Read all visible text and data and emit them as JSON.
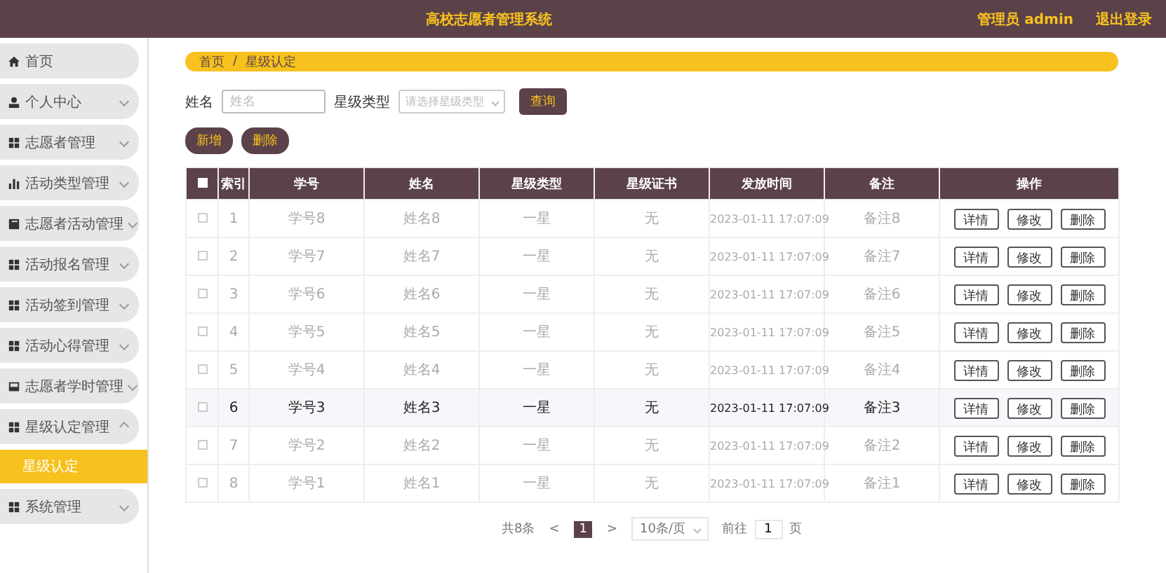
{
  "header": {
    "title": "高校志愿者管理系统",
    "user": "管理员 admin",
    "logout": "退出登录"
  },
  "sidebar": {
    "items": [
      {
        "label": "首页",
        "kind": "link"
      },
      {
        "label": "个人中心",
        "kind": "menu",
        "expanded": false
      },
      {
        "label": "志愿者管理",
        "kind": "menu",
        "expanded": false
      },
      {
        "label": "活动类型管理",
        "kind": "menu",
        "expanded": false
      },
      {
        "label": "志愿者活动管理",
        "kind": "menu",
        "expanded": false
      },
      {
        "label": "活动报名管理",
        "kind": "menu",
        "expanded": false
      },
      {
        "label": "活动签到管理",
        "kind": "menu",
        "expanded": false
      },
      {
        "label": "活动心得管理",
        "kind": "menu",
        "expanded": false
      },
      {
        "label": "志愿者学时管理",
        "kind": "menu",
        "expanded": false
      },
      {
        "label": "星级认定管理",
        "kind": "menu",
        "expanded": true,
        "children": [
          {
            "label": "星级认定",
            "selected": true
          }
        ]
      },
      {
        "label": "系统管理",
        "kind": "menu",
        "expanded": false
      }
    ]
  },
  "breadcrumb": [
    "首页",
    "星级认定"
  ],
  "breadcrumb_separator": "/",
  "search": {
    "fields": [
      {
        "label": "姓名",
        "kind": "text",
        "placeholder": "姓名"
      },
      {
        "label": "星级类型",
        "kind": "select",
        "placeholder": "请选择星级类型"
      }
    ],
    "button": "查询"
  },
  "actions": [
    "新增",
    "删除"
  ],
  "table": {
    "header_checked": false,
    "columns": [
      "索引",
      "学号",
      "姓名",
      "星级类型",
      "星级证书",
      "发放时间",
      "备注",
      "操作"
    ],
    "rows": [
      {
        "checked": false,
        "highlighted": false,
        "cells": [
          "1",
          "学号8",
          "姓名8",
          "一星",
          "无",
          "2023-01-11 17:07:09",
          "备注8"
        ],
        "buttons": [
          "详情",
          "修改",
          "删除"
        ]
      },
      {
        "checked": false,
        "highlighted": false,
        "cells": [
          "2",
          "学号7",
          "姓名7",
          "一星",
          "无",
          "2023-01-11 17:07:09",
          "备注7"
        ],
        "buttons": [
          "详情",
          "修改",
          "删除"
        ]
      },
      {
        "checked": false,
        "highlighted": false,
        "cells": [
          "3",
          "学号6",
          "姓名6",
          "一星",
          "无",
          "2023-01-11 17:07:09",
          "备注6"
        ],
        "buttons": [
          "详情",
          "修改",
          "删除"
        ]
      },
      {
        "checked": false,
        "highlighted": false,
        "cells": [
          "4",
          "学号5",
          "姓名5",
          "一星",
          "无",
          "2023-01-11 17:07:09",
          "备注5"
        ],
        "buttons": [
          "详情",
          "修改",
          "删除"
        ]
      },
      {
        "checked": false,
        "highlighted": false,
        "cells": [
          "5",
          "学号4",
          "姓名4",
          "一星",
          "无",
          "2023-01-11 17:07:09",
          "备注4"
        ],
        "buttons": [
          "详情",
          "修改",
          "删除"
        ]
      },
      {
        "checked": false,
        "highlighted": true,
        "cells": [
          "6",
          "学号3",
          "姓名3",
          "一星",
          "无",
          "2023-01-11 17:07:09",
          "备注3"
        ],
        "buttons": [
          "详情",
          "修改",
          "删除"
        ]
      },
      {
        "checked": false,
        "highlighted": false,
        "cells": [
          "7",
          "学号2",
          "姓名2",
          "一星",
          "无",
          "2023-01-11 17:07:09",
          "备注2"
        ],
        "buttons": [
          "详情",
          "修改",
          "删除"
        ]
      },
      {
        "checked": false,
        "highlighted": false,
        "cells": [
          "8",
          "学号1",
          "姓名1",
          "一星",
          "无",
          "2023-01-11 17:07:09",
          "备注1"
        ],
        "buttons": [
          "详情",
          "修改",
          "删除"
        ]
      }
    ]
  },
  "pagination": {
    "total": "共8条",
    "prev": "<",
    "pages": [
      {
        "label": "1",
        "selected": true
      }
    ],
    "next": ">",
    "page_size": "10条/页",
    "goto_label": "前往",
    "goto_value": "1",
    "goto_unit": "页"
  }
}
